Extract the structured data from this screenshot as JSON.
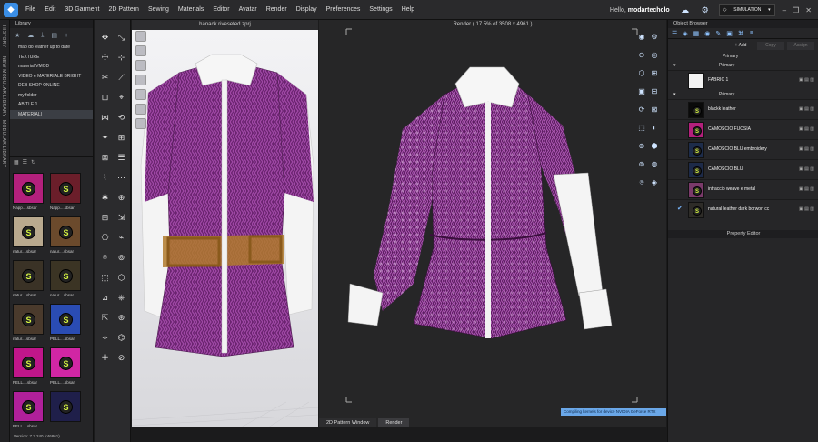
{
  "menu": {
    "items": [
      "File",
      "Edit",
      "3D Garment",
      "2D Pattern",
      "Sewing",
      "Materials",
      "Editor",
      "Avatar",
      "Render",
      "Display",
      "Preferences",
      "Settings",
      "Help"
    ],
    "hello_prefix": "Hello, ",
    "user": "modartechclo",
    "simulation_label": "SIMULATION"
  },
  "left_strip": {
    "tabs": [
      "HISTORY",
      "NEW MODULAR LIBRARY",
      "MODULAR LIBRARY"
    ]
  },
  "library": {
    "title": "Library",
    "tree": [
      "map do leather up to date",
      "TEXTURE",
      "material VMOD",
      "VIDEO e MATERIALE BRIGHT",
      "DEB SHOP ONLINE",
      "my folder",
      "ABITI E.1",
      "MATERIALI"
    ],
    "selected_index": 7,
    "thumbs": [
      {
        "caption": "Napp....sbsar",
        "color": "#b3207c"
      },
      {
        "caption": "Napp....sbsar",
        "color": "#6b1e2a"
      },
      {
        "caption": "natur....sbsar",
        "color": "#b9a98e"
      },
      {
        "caption": "natur....sbsar",
        "color": "#6b4a2c"
      },
      {
        "caption": "natur....sbsar",
        "color": "#3a3226"
      },
      {
        "caption": "natur....sbsar",
        "color": "#3b3424"
      },
      {
        "caption": "natur....sbsar",
        "color": "#4a3a2c"
      },
      {
        "caption": "PELL....sbsar",
        "color": "#2a4cb3"
      },
      {
        "caption": "PELL....sbsar",
        "color": "#c0168a"
      },
      {
        "caption": "PELL....sbsar",
        "color": "#d126a4"
      },
      {
        "caption": "PELL....sbsar",
        "color": "#b0209a"
      },
      {
        "caption": "",
        "color": "#1f1f4a"
      }
    ],
    "version": "Version: 7.3.240 (r46861)"
  },
  "viewport3d": {
    "title": "hanack riveseted.zprj"
  },
  "render": {
    "title": "Render ( 17.5% of 3508 x 4961 )",
    "status": "Compiling kernels for device NVIDIA GeForce RTX"
  },
  "bottom_tabs": [
    "2D Pattern Window",
    "Render"
  ],
  "object_browser": {
    "title": "Object Browser",
    "add_label": "+ Add",
    "copy_label": "Copy",
    "assign_label": "Assign",
    "primary_label": "Primary",
    "fabrics": [
      {
        "name": "FABRIC 1",
        "color": "#f2f2f2",
        "badge": false,
        "checked": false
      },
      {
        "name": "blackk leather",
        "color": "#0a0a0a",
        "badge": true,
        "checked": false
      },
      {
        "name": "CAMOSCIO FUCSIA",
        "color": "#b3207c",
        "badge": true,
        "checked": false
      },
      {
        "name": "CAMOSCIO BLU embroidery",
        "color": "#1d2c4a",
        "badge": true,
        "checked": false
      },
      {
        "name": "CAMOSCIO BLU",
        "color": "#1d2a48",
        "badge": true,
        "checked": false
      },
      {
        "name": "intraccio weave e metal",
        "color": "#7a3a6a",
        "badge": true,
        "checked": false
      },
      {
        "name": "natural leather dark borwon cc",
        "color": "#2e2c28",
        "badge": true,
        "checked": true
      }
    ]
  },
  "property_editor": {
    "title": "Property Editor"
  },
  "colors": {
    "accent": "#3a8ee6",
    "sbsar_badge": "#d6f542",
    "jacket_purple": "#7a2a7e",
    "status_bg": "#6aa7e8"
  }
}
